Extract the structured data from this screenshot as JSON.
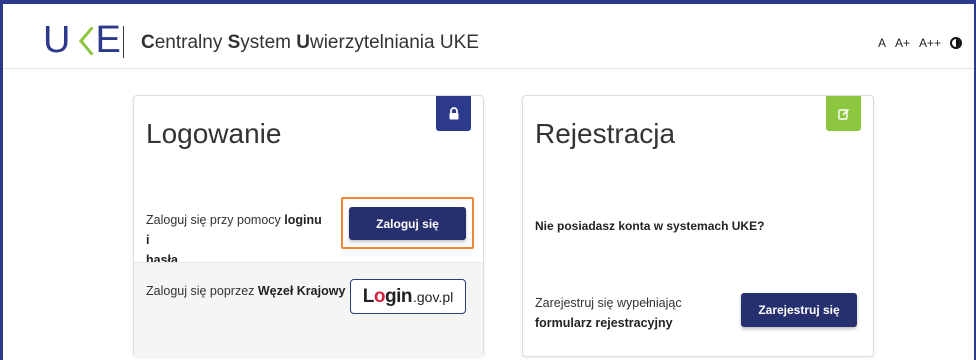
{
  "header": {
    "logo_text": "UKE",
    "title_parts": [
      {
        "text": "C",
        "bold": true
      },
      {
        "text": "entralny ",
        "bold": false
      },
      {
        "text": "S",
        "bold": true
      },
      {
        "text": "ystem ",
        "bold": false
      },
      {
        "text": "U",
        "bold": true
      },
      {
        "text": "wierzytelniania UKE",
        "bold": false
      }
    ],
    "font_size_controls": [
      "A",
      "A+",
      "A++"
    ],
    "contrast_icon": "contrast-icon"
  },
  "login_card": {
    "title": "Logowanie",
    "badge_icon": "lock-icon",
    "badge_color": "#2d3a8c",
    "option1_text_before": "Zaloguj się przy pomocy ",
    "option1_text_bold1": "loginu i",
    "option1_text_bold2": "hasła",
    "login_button": "Zaloguj się",
    "option2_text_before": "Zaloguj się poprzez ",
    "option2_text_bold": "Węzeł Krajowy",
    "logingov_main": "Login",
    "logingov_suffix": ".gov.pl"
  },
  "register_card": {
    "title": "Rejestracja",
    "badge_icon": "edit-icon",
    "badge_color": "#8dc63f",
    "question": "Nie posiadasz konta w systemach UKE?",
    "text_before": "Zarejestruj się wypełniając",
    "text_bold": "formularz rejestracyjny",
    "register_button": "Zarejestruj się"
  },
  "colors": {
    "brand_blue": "#2d3a8c",
    "button_blue": "#27306e",
    "brand_green": "#8dc63f",
    "highlight_orange": "#f0873a"
  }
}
